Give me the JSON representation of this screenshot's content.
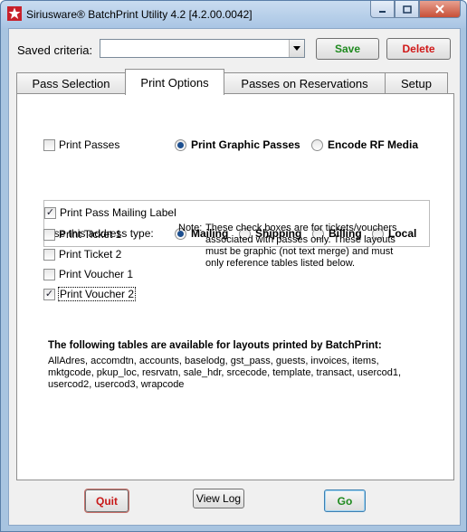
{
  "window": {
    "title": "Siriusware® BatchPrint Utility  4.2  [4.2.00.0042]"
  },
  "criteria": {
    "label": "Saved criteria:",
    "value": "",
    "save_label": "Save",
    "delete_label": "Delete"
  },
  "tabs": [
    {
      "label": "Pass Selection"
    },
    {
      "label": "Print Options"
    },
    {
      "label": "Passes on Reservations"
    },
    {
      "label": "Setup"
    }
  ],
  "print_options": {
    "print_passes": {
      "label": "Print Passes",
      "checked": false
    },
    "pass_modes": [
      {
        "label": "Print Graphic Passes",
        "selected": true
      },
      {
        "label": "Encode RF Media",
        "selected": false
      }
    ],
    "mailing_label": {
      "label": "Print Pass Mailing Label",
      "checked": true
    },
    "address_type_label": "Use this address type:",
    "address_types": [
      {
        "label": "Mailing",
        "selected": true
      },
      {
        "label": "Shipping",
        "selected": false
      },
      {
        "label": "Billing",
        "selected": false
      },
      {
        "label": "Local",
        "selected": false
      }
    ],
    "tickets": [
      {
        "label": "Print Ticket 1",
        "checked": false
      },
      {
        "label": "Print Ticket 2",
        "checked": false
      },
      {
        "label": "Print Voucher 1",
        "checked": false
      },
      {
        "label": "Print Voucher 2",
        "checked": true
      }
    ],
    "note_label": "Note:",
    "note_text": "These check boxes are for tickets/vouchers associated with passes only. These layouts must be graphic (not text merge) and must only reference tables listed below.",
    "tables_heading": "The following tables are available for layouts printed by BatchPrint:",
    "tables_list": "AllAdres, accomdtn, accounts, baselodg, gst_pass, guests, invoices, items, mktgcode, pkup_loc, resrvatn, sale_hdr, srcecode, template, transact, usercod1, usercod2, usercod3, wrapcode"
  },
  "footer": {
    "quit_label": "Quit",
    "view_log_label": "View Log",
    "go_label": "Go"
  }
}
